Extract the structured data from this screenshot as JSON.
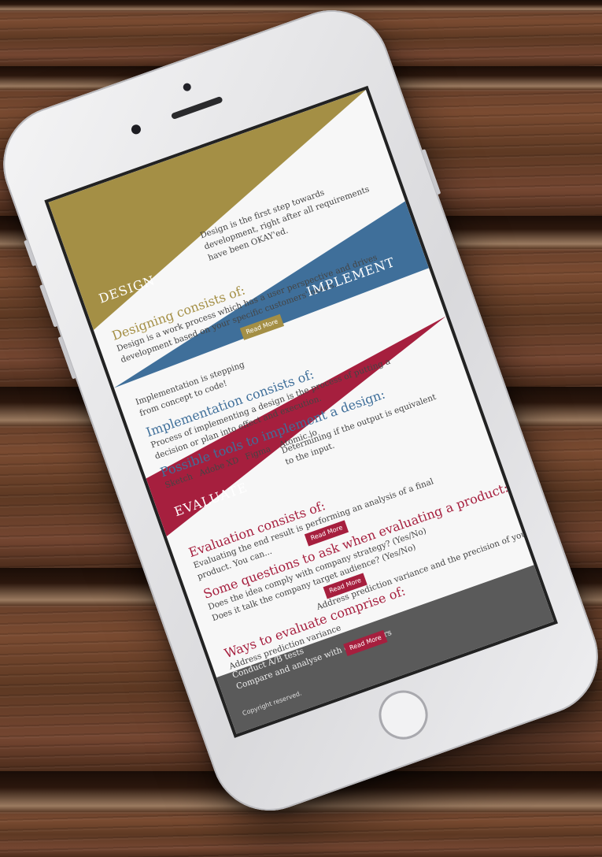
{
  "design": {
    "title": "DESIGN",
    "intro": [
      "Design is the first step towards",
      "development, right after all requirements",
      "have been OKAY'ed."
    ],
    "heading": "Designing consists of:",
    "body": [
      "Design is a work process which has a user perspective and drives",
      "development based on your specific customers' needs."
    ],
    "button": "Read More"
  },
  "implement": {
    "title": "IMPLEMENT",
    "intro": [
      "Implementation is stepping",
      "from concept to code!"
    ],
    "heading": "Implementation consists of:",
    "body": [
      "Process of implementing a design is the process of putting a",
      "decision or plan into effect and execution."
    ],
    "tools_heading": "Possible tools to implement a design:",
    "tools": [
      "Sketch",
      "Adobe XD",
      "Figma",
      "Atomic.io"
    ]
  },
  "evaluate": {
    "title": "EVALUATE",
    "intro": [
      "Determining if the output is equivalent",
      "to the input."
    ],
    "heading": "Evaluation consists of:",
    "body": [
      "Evaluating the end result is performing an analysis of a final",
      "product. You can..."
    ],
    "button": "Read More",
    "questions_heading": "Some questions to ask when evaluating a product:",
    "questions": [
      "Does the idea comply with company strategy? (Yes/No)",
      "Does it talk the company target audience? (Yes/No)"
    ],
    "questions_button": "Read More",
    "ways_heading": "Ways to evaluate comprise of:",
    "ways_intro": "Address prediction variance and the precision of your estimates.",
    "ways": [
      "Address prediction variance",
      "Conduct A/B tests",
      "Compare and analyse with competitors"
    ],
    "ways_button": "Read More"
  },
  "footer": {
    "copyright": "Copyright reserved."
  },
  "colors": {
    "gold": "#a48f45",
    "blue": "#3f6f9a",
    "red": "#a61f3e",
    "footer": "#5a5a5a"
  },
  "icons": [
    "home-button-icon",
    "camera-icon",
    "speaker-icon"
  ]
}
